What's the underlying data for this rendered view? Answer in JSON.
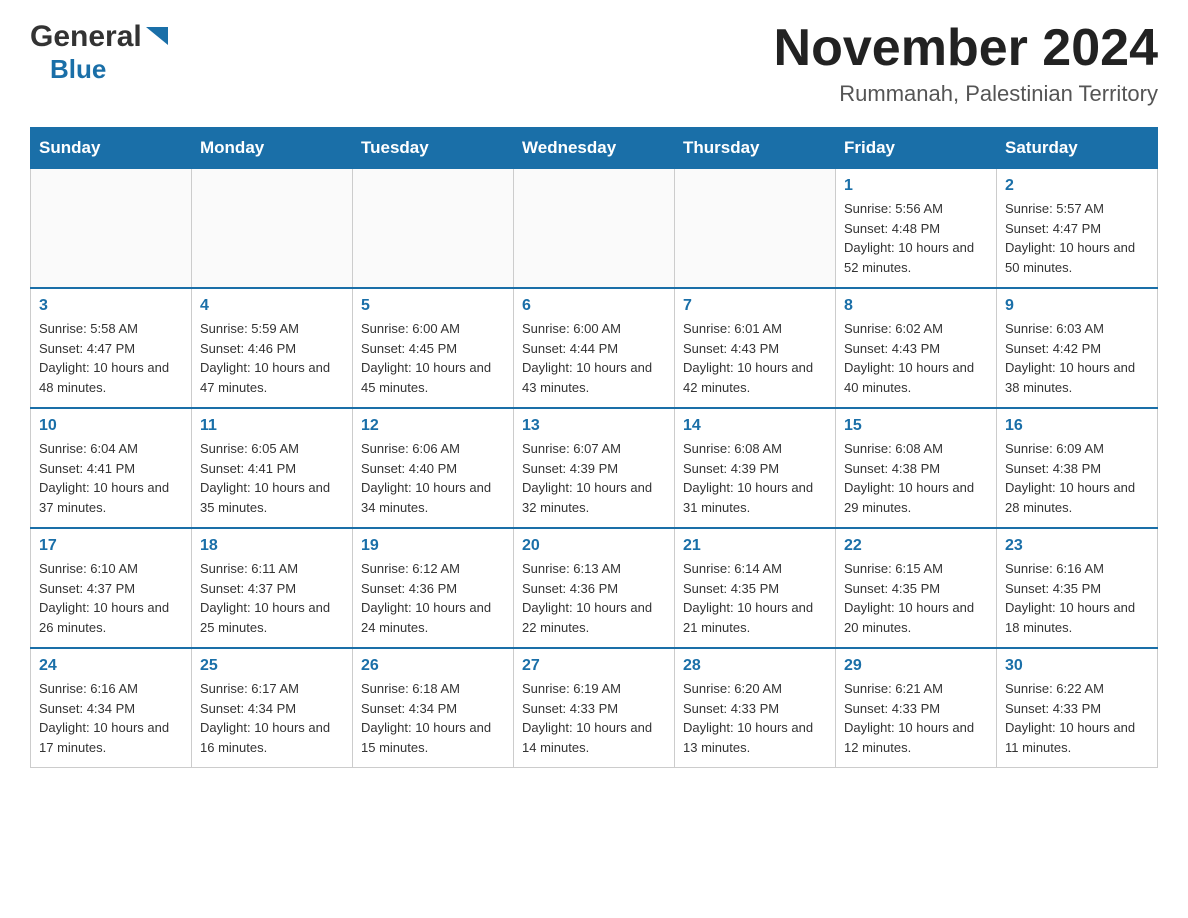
{
  "header": {
    "logo_general": "General",
    "logo_blue": "Blue",
    "month_title": "November 2024",
    "location": "Rummanah, Palestinian Territory"
  },
  "weekdays": [
    "Sunday",
    "Monday",
    "Tuesday",
    "Wednesday",
    "Thursday",
    "Friday",
    "Saturday"
  ],
  "weeks": [
    [
      {
        "day": "",
        "info": ""
      },
      {
        "day": "",
        "info": ""
      },
      {
        "day": "",
        "info": ""
      },
      {
        "day": "",
        "info": ""
      },
      {
        "day": "",
        "info": ""
      },
      {
        "day": "1",
        "info": "Sunrise: 5:56 AM\nSunset: 4:48 PM\nDaylight: 10 hours and 52 minutes."
      },
      {
        "day": "2",
        "info": "Sunrise: 5:57 AM\nSunset: 4:47 PM\nDaylight: 10 hours and 50 minutes."
      }
    ],
    [
      {
        "day": "3",
        "info": "Sunrise: 5:58 AM\nSunset: 4:47 PM\nDaylight: 10 hours and 48 minutes."
      },
      {
        "day": "4",
        "info": "Sunrise: 5:59 AM\nSunset: 4:46 PM\nDaylight: 10 hours and 47 minutes."
      },
      {
        "day": "5",
        "info": "Sunrise: 6:00 AM\nSunset: 4:45 PM\nDaylight: 10 hours and 45 minutes."
      },
      {
        "day": "6",
        "info": "Sunrise: 6:00 AM\nSunset: 4:44 PM\nDaylight: 10 hours and 43 minutes."
      },
      {
        "day": "7",
        "info": "Sunrise: 6:01 AM\nSunset: 4:43 PM\nDaylight: 10 hours and 42 minutes."
      },
      {
        "day": "8",
        "info": "Sunrise: 6:02 AM\nSunset: 4:43 PM\nDaylight: 10 hours and 40 minutes."
      },
      {
        "day": "9",
        "info": "Sunrise: 6:03 AM\nSunset: 4:42 PM\nDaylight: 10 hours and 38 minutes."
      }
    ],
    [
      {
        "day": "10",
        "info": "Sunrise: 6:04 AM\nSunset: 4:41 PM\nDaylight: 10 hours and 37 minutes."
      },
      {
        "day": "11",
        "info": "Sunrise: 6:05 AM\nSunset: 4:41 PM\nDaylight: 10 hours and 35 minutes."
      },
      {
        "day": "12",
        "info": "Sunrise: 6:06 AM\nSunset: 4:40 PM\nDaylight: 10 hours and 34 minutes."
      },
      {
        "day": "13",
        "info": "Sunrise: 6:07 AM\nSunset: 4:39 PM\nDaylight: 10 hours and 32 minutes."
      },
      {
        "day": "14",
        "info": "Sunrise: 6:08 AM\nSunset: 4:39 PM\nDaylight: 10 hours and 31 minutes."
      },
      {
        "day": "15",
        "info": "Sunrise: 6:08 AM\nSunset: 4:38 PM\nDaylight: 10 hours and 29 minutes."
      },
      {
        "day": "16",
        "info": "Sunrise: 6:09 AM\nSunset: 4:38 PM\nDaylight: 10 hours and 28 minutes."
      }
    ],
    [
      {
        "day": "17",
        "info": "Sunrise: 6:10 AM\nSunset: 4:37 PM\nDaylight: 10 hours and 26 minutes."
      },
      {
        "day": "18",
        "info": "Sunrise: 6:11 AM\nSunset: 4:37 PM\nDaylight: 10 hours and 25 minutes."
      },
      {
        "day": "19",
        "info": "Sunrise: 6:12 AM\nSunset: 4:36 PM\nDaylight: 10 hours and 24 minutes."
      },
      {
        "day": "20",
        "info": "Sunrise: 6:13 AM\nSunset: 4:36 PM\nDaylight: 10 hours and 22 minutes."
      },
      {
        "day": "21",
        "info": "Sunrise: 6:14 AM\nSunset: 4:35 PM\nDaylight: 10 hours and 21 minutes."
      },
      {
        "day": "22",
        "info": "Sunrise: 6:15 AM\nSunset: 4:35 PM\nDaylight: 10 hours and 20 minutes."
      },
      {
        "day": "23",
        "info": "Sunrise: 6:16 AM\nSunset: 4:35 PM\nDaylight: 10 hours and 18 minutes."
      }
    ],
    [
      {
        "day": "24",
        "info": "Sunrise: 6:16 AM\nSunset: 4:34 PM\nDaylight: 10 hours and 17 minutes."
      },
      {
        "day": "25",
        "info": "Sunrise: 6:17 AM\nSunset: 4:34 PM\nDaylight: 10 hours and 16 minutes."
      },
      {
        "day": "26",
        "info": "Sunrise: 6:18 AM\nSunset: 4:34 PM\nDaylight: 10 hours and 15 minutes."
      },
      {
        "day": "27",
        "info": "Sunrise: 6:19 AM\nSunset: 4:33 PM\nDaylight: 10 hours and 14 minutes."
      },
      {
        "day": "28",
        "info": "Sunrise: 6:20 AM\nSunset: 4:33 PM\nDaylight: 10 hours and 13 minutes."
      },
      {
        "day": "29",
        "info": "Sunrise: 6:21 AM\nSunset: 4:33 PM\nDaylight: 10 hours and 12 minutes."
      },
      {
        "day": "30",
        "info": "Sunrise: 6:22 AM\nSunset: 4:33 PM\nDaylight: 10 hours and 11 minutes."
      }
    ]
  ]
}
